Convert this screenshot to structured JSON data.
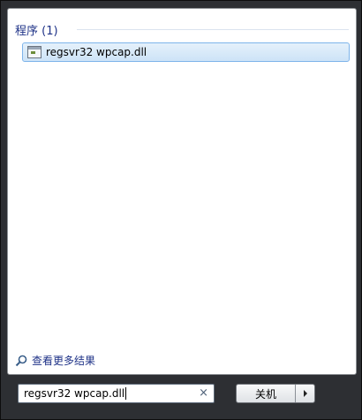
{
  "results": {
    "section_title": "程序 (1)",
    "items": [
      {
        "label": "regsvr32 wpcap.dll",
        "icon": "console-app-icon"
      }
    ]
  },
  "more_results_label": "查看更多结果",
  "search": {
    "value": "regsvr32 wpcap.dll",
    "clear_icon": "×"
  },
  "power": {
    "label": "关机"
  }
}
